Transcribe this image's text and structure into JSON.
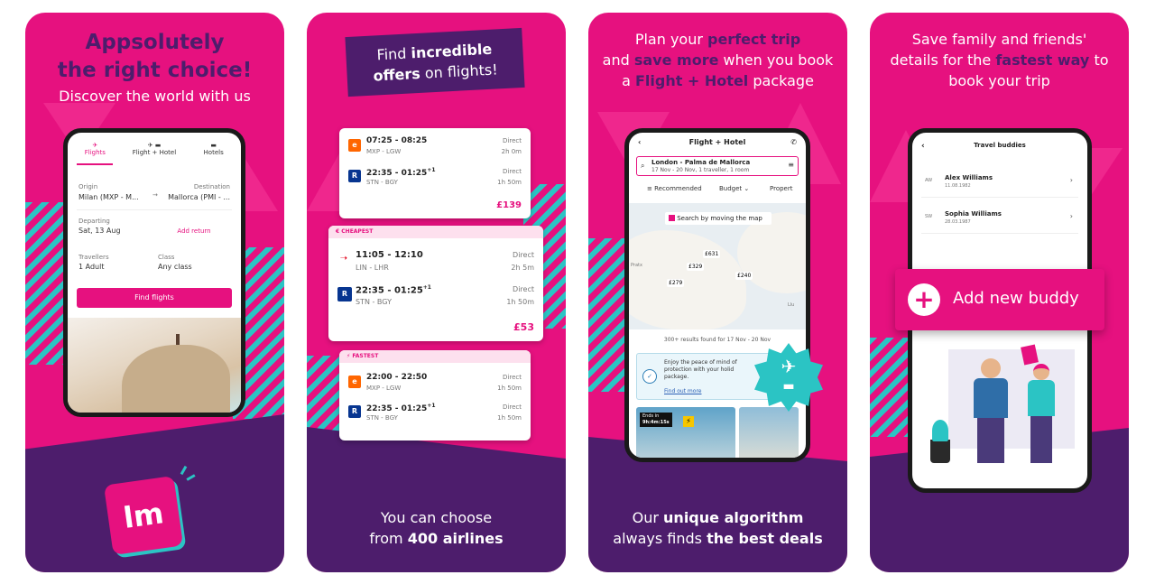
{
  "colors": {
    "brand_pink": "#e6117f",
    "brand_purple": "#4d1d6c",
    "accent_teal": "#2bc4c4"
  },
  "panel1": {
    "headline_1": "Appsolutely",
    "headline_2": "the right choice!",
    "subline": "Discover the world with us",
    "tabs": [
      "Flights",
      "Flight + Hotel",
      "Hotels"
    ],
    "origin_label": "Origin",
    "origin_value": "Milan (MXP - M...",
    "destination_label": "Destination",
    "destination_value": "Mallorca (PMI - ...",
    "departing_label": "Departing",
    "departing_value": "Sat, 13 Aug",
    "add_return": "Add return",
    "travellers_label": "Travellers",
    "travellers_value": "1 Adult",
    "class_label": "Class",
    "class_value": "Any class",
    "search_button": "Find flights",
    "logo_text": "lm"
  },
  "panel2": {
    "banner_1a": "Find ",
    "banner_1b": "incredible",
    "banner_2a": "offers",
    "banner_2b": " on flights!",
    "card1": {
      "out_time": "07:25 - 08:25",
      "out_route": "MXP - LGW",
      "out_stops": "Direct",
      "out_dur": "2h 0m",
      "out_logo": "e",
      "ret_time": "22:35 - 01:25",
      "ret_plus": "+1",
      "ret_route": "STN - BGY",
      "ret_stops": "Direct",
      "ret_dur": "1h 50m",
      "ret_logo": "R",
      "price": "£139"
    },
    "card2": {
      "tag": "CHEAPEST",
      "out_time": "11:05 - 12:10",
      "out_route": "LIN - LHR",
      "out_stops": "Direct",
      "out_dur": "2h 5m",
      "ret_time": "22:35 - 01:25",
      "ret_plus": "+1",
      "ret_route": "STN - BGY",
      "ret_stops": "Direct",
      "ret_dur": "1h 50m",
      "ret_logo": "R",
      "price": "£53"
    },
    "card3": {
      "tag": "FASTEST",
      "out_time": "22:00 - 22:50",
      "out_route": "MXP - LGW",
      "out_stops": "Direct",
      "out_dur": "1h 50m",
      "out_logo": "e",
      "ret_time": "22:35 - 01:25",
      "ret_plus": "+1",
      "ret_route": "STN - BGY",
      "ret_stops": "Direct",
      "ret_dur": "1h 50m",
      "ret_logo": "R"
    },
    "caption_1": "You can choose",
    "caption_2a": "from ",
    "caption_2b": "400 airlines"
  },
  "panel3": {
    "h1a": "Plan your ",
    "h1b": "perfect trip",
    "h2a": "and ",
    "h2b": "save more",
    "h2c": " when you book",
    "h3a": "a ",
    "h3b": "Flight + Hotel",
    "h3c": " package",
    "screen_title": "Flight + Hotel",
    "search_line1": "London - Palma de Mallorca",
    "search_line2": "17 Nov - 20 Nov, 1 traveller, 1 room",
    "filter_recommended": "Recommended",
    "filter_budget": "Budget",
    "filter_property": "Propert",
    "map_checkbox": "Search by moving the map",
    "map_prices": [
      "£631",
      "£329",
      "£240",
      "£279"
    ],
    "map_labels": [
      "Pratx",
      "Llu"
    ],
    "results": "300+ results found for 17 Nov - 20 Nov",
    "protect_text": "Enjoy the peace of mind of protection with your holid package.",
    "find_out_more": "Find out more",
    "ends_in_label": "Ends in",
    "ends_in_value": "9h:4m:15s",
    "caption_1a": "Our ",
    "caption_1b": "unique algorithm",
    "caption_2a": "always finds ",
    "caption_2b": "the best deals"
  },
  "panel4": {
    "h1": "Save family and friends'",
    "h2a": "details for the ",
    "h2b": "fastest way",
    "h2c": " to",
    "h3": "book your trip",
    "screen_title": "Travel buddies",
    "buddies": [
      {
        "initials": "AW",
        "name": "Alex Williams",
        "dob": "11.08.1982"
      },
      {
        "initials": "SW",
        "name": "Sophia Williams",
        "dob": "28.03.1987"
      }
    ],
    "add_button": "Add new buddy"
  }
}
